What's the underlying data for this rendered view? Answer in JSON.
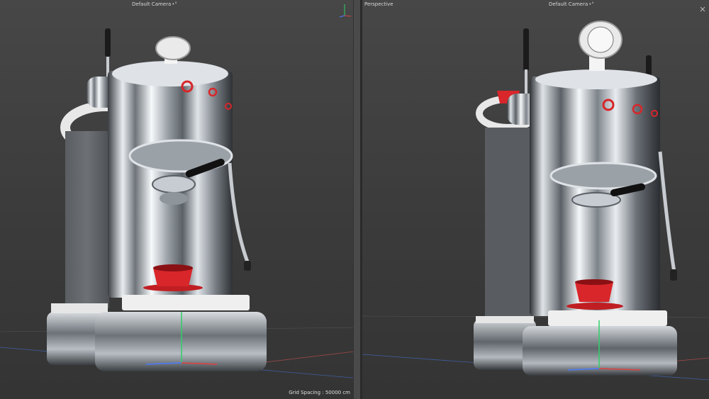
{
  "viewports": {
    "left": {
      "camera": "Default Camera",
      "camera_icon": "dot-arrow-icon",
      "grid_spacing": "Grid Spacing : 50000 cm"
    },
    "right": {
      "label": "Perspective",
      "camera": "Default Camera",
      "camera_icon": "dot-arrow-icon"
    }
  },
  "gizmo_axes": {
    "x_color": "#4a7bff",
    "y_color": "#30d06a",
    "z_color": "#e04040"
  },
  "colors": {
    "cup": "#d8262a",
    "chrome_light": "#f2f4f6",
    "chrome_dark": "#2a2d31",
    "base_white": "#ececec"
  }
}
